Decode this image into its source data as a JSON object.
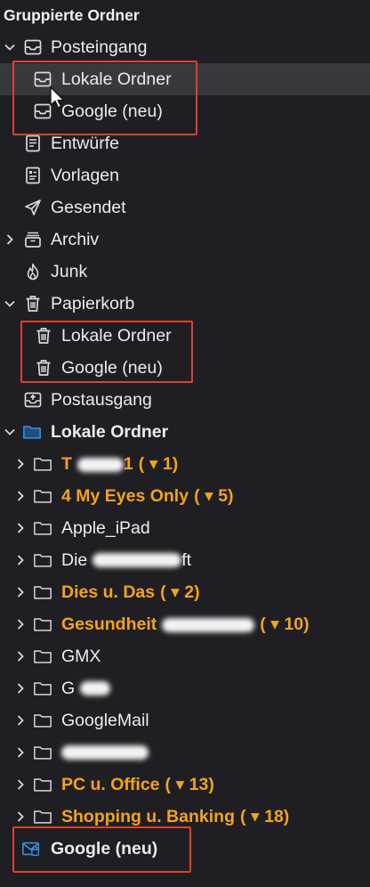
{
  "header": {
    "title": "Gruppierte Ordner"
  },
  "colors": {
    "accent_blue": "#3a8ee6",
    "unread_orange": "#f4a31a",
    "highlight_red": "#e0402e"
  },
  "tree": {
    "inbox": {
      "label": "Posteingang",
      "children": [
        {
          "label": "Lokale Ordner"
        },
        {
          "label": "Google (neu)"
        }
      ]
    },
    "drafts": {
      "label": "Entwürfe"
    },
    "templates": {
      "label": "Vorlagen"
    },
    "sent": {
      "label": "Gesendet"
    },
    "archive": {
      "label": "Archiv"
    },
    "junk": {
      "label": "Junk"
    },
    "trash": {
      "label": "Papierkorb",
      "children": [
        {
          "label": "Lokale Ordner"
        },
        {
          "label": "Google (neu)"
        }
      ]
    },
    "outbox": {
      "label": "Postausgang"
    },
    "local_folders": {
      "label": "Lokale Ordner",
      "folders": [
        {
          "label": "T",
          "suffix": "1",
          "count": "( ▾ 1)"
        },
        {
          "label": "4 My Eyes Only",
          "count": "( ▾ 5)"
        },
        {
          "label": "Apple_iPad"
        },
        {
          "label": "Die",
          "suffix": "ft"
        },
        {
          "label": "Dies u. Das",
          "count": "( ▾ 2)"
        },
        {
          "label": "Gesundheit",
          "count": "( ▾ 10)"
        },
        {
          "label": "GMX"
        },
        {
          "label": "G"
        },
        {
          "label": "GoogleMail"
        },
        {
          "label": ""
        },
        {
          "label": "PC u. Office",
          "count": "( ▾ 13)"
        },
        {
          "label": "Shopping u. Banking",
          "count": "( ▾ 18)"
        }
      ]
    },
    "google_account": {
      "label": "Google (neu)"
    }
  }
}
